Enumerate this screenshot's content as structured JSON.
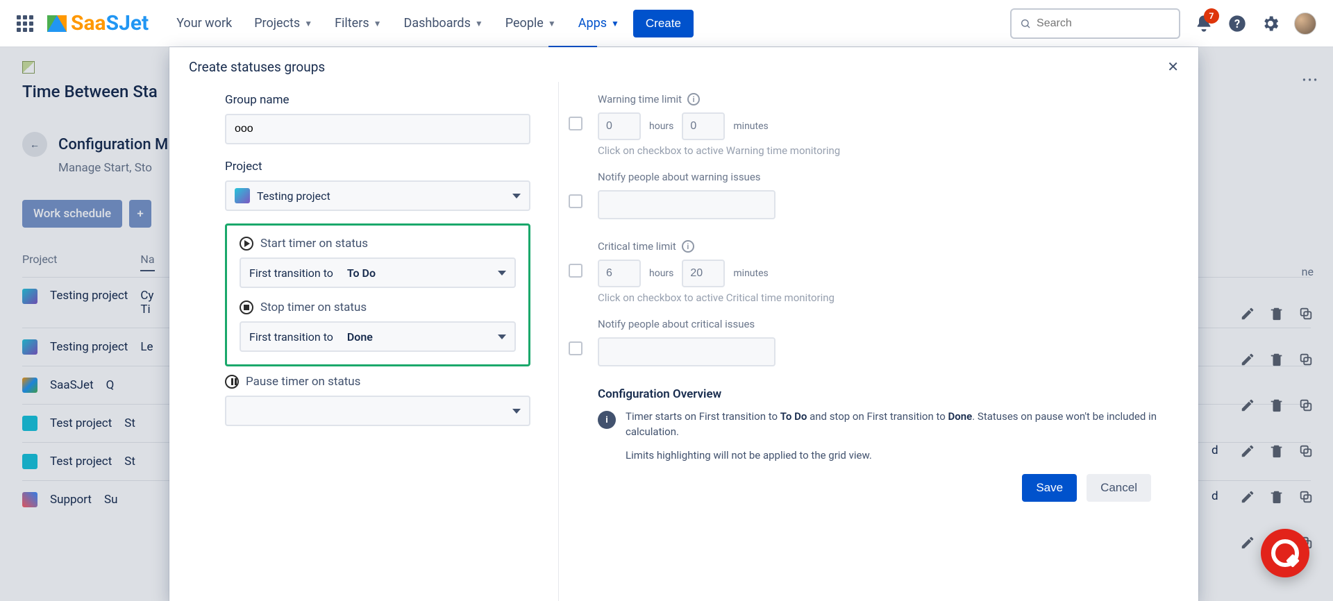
{
  "nav": {
    "logo": "SaaSJet",
    "items": [
      {
        "label": "Your work",
        "dropdown": false
      },
      {
        "label": "Projects",
        "dropdown": true
      },
      {
        "label": "Filters",
        "dropdown": true
      },
      {
        "label": "Dashboards",
        "dropdown": true
      },
      {
        "label": "People",
        "dropdown": true
      },
      {
        "label": "Apps",
        "dropdown": true,
        "active": true
      }
    ],
    "create": "Create",
    "search_placeholder": "Search",
    "notif_count": "7"
  },
  "page": {
    "title": "Time Between Sta",
    "section": "Configuration M",
    "subtitle": "Manage Start, Sto",
    "chips": {
      "work": "Work schedule",
      "add": "+"
    },
    "table": {
      "headers": {
        "project": "Project",
        "name": "Na",
        "right": "ne"
      },
      "rows": [
        {
          "project": "Testing project",
          "name": "Cy",
          "extra": "Ti",
          "right": ""
        },
        {
          "project": "Testing project",
          "name": "Le",
          "right": ""
        },
        {
          "project": "SaaSJet",
          "name": "Q",
          "right": ""
        },
        {
          "project": "Test project",
          "name": "St",
          "right": "d"
        },
        {
          "project": "Test project",
          "name": "St",
          "right": "d"
        },
        {
          "project": "Support",
          "name": "Su",
          "right": ""
        }
      ]
    }
  },
  "modal": {
    "title": "Create statuses groups",
    "group_name_label": "Group name",
    "group_name_value": "ooo",
    "project_label": "Project",
    "project_value": "Testing project",
    "start_label": "Start timer on status",
    "start_prefix": "First transition to",
    "start_value": "To Do",
    "stop_label": "Stop timer on status",
    "stop_prefix": "First transition to",
    "stop_value": "Done",
    "pause_label": "Pause timer on status",
    "warning": {
      "label": "Warning time limit",
      "hours": "0",
      "hours_lbl": "hours",
      "minutes": "0",
      "minutes_lbl": "minutes",
      "hint": "Click on checkbox to active Warning time monitoring",
      "notify_label": "Notify people about warning issues"
    },
    "critical": {
      "label": "Critical time limit",
      "hours": "6",
      "hours_lbl": "hours",
      "minutes": "20",
      "minutes_lbl": "minutes",
      "hint": "Click on checkbox to active Critical time monitoring",
      "notify_label": "Notify people about critical issues"
    },
    "overview": {
      "title": "Configuration Overview",
      "line1_a": "Timer starts on First transition to ",
      "line1_b": "To Do",
      "line1_c": " and stop on First transition to ",
      "line1_d": "Done",
      "line1_e": ". Statuses on pause won't be included in calculation.",
      "line2": "Limits highlighting will not be applied to the grid view."
    },
    "save": "Save",
    "cancel": "Cancel"
  }
}
